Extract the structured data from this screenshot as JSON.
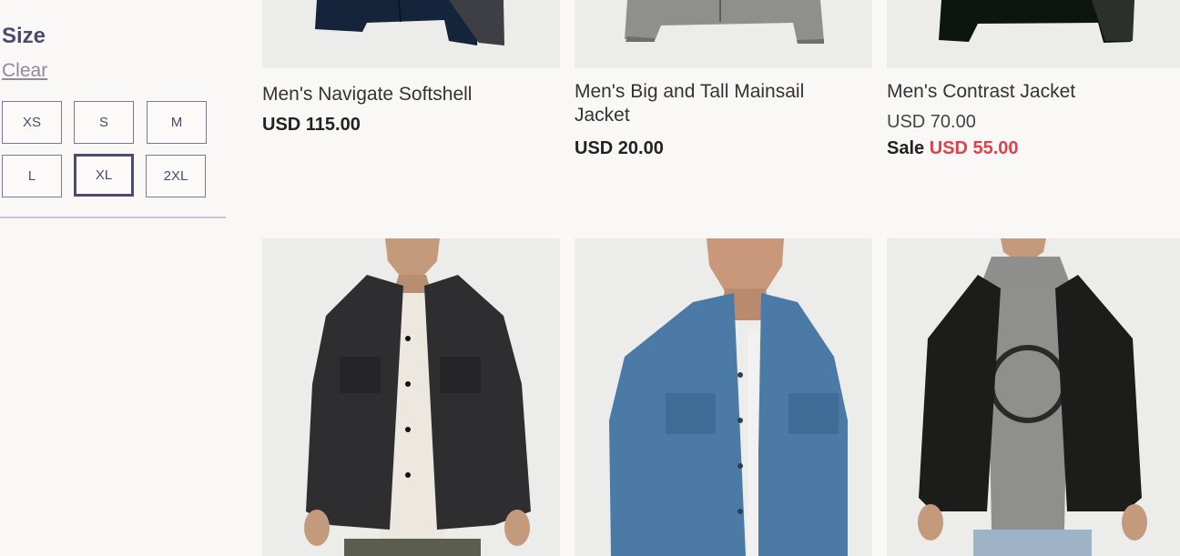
{
  "filters": {
    "size": {
      "heading": "Size",
      "clear_label": "Clear",
      "options": [
        "XS",
        "S",
        "M",
        "L",
        "XL",
        "2XL"
      ],
      "selected": "XL"
    }
  },
  "products_top": [
    {
      "title": "Men's Navigate Softshell",
      "price": "USD 115.00"
    },
    {
      "title_line1": "Men's Big and Tall Mainsail",
      "title_line2": "Jacket",
      "price": "USD 20.00"
    },
    {
      "title": "Men's Contrast Jacket",
      "price": "USD 70.00",
      "sale_label": "Sale",
      "sale_price": "USD 55.00"
    }
  ],
  "products_bottom": [
    {
      "image": "black-denim-jacket"
    },
    {
      "image": "blue-denim-jacket"
    },
    {
      "image": "black-hooded-jacket"
    }
  ],
  "colors": {
    "accent": "#4d4a6b",
    "sale": "#e0404a"
  }
}
